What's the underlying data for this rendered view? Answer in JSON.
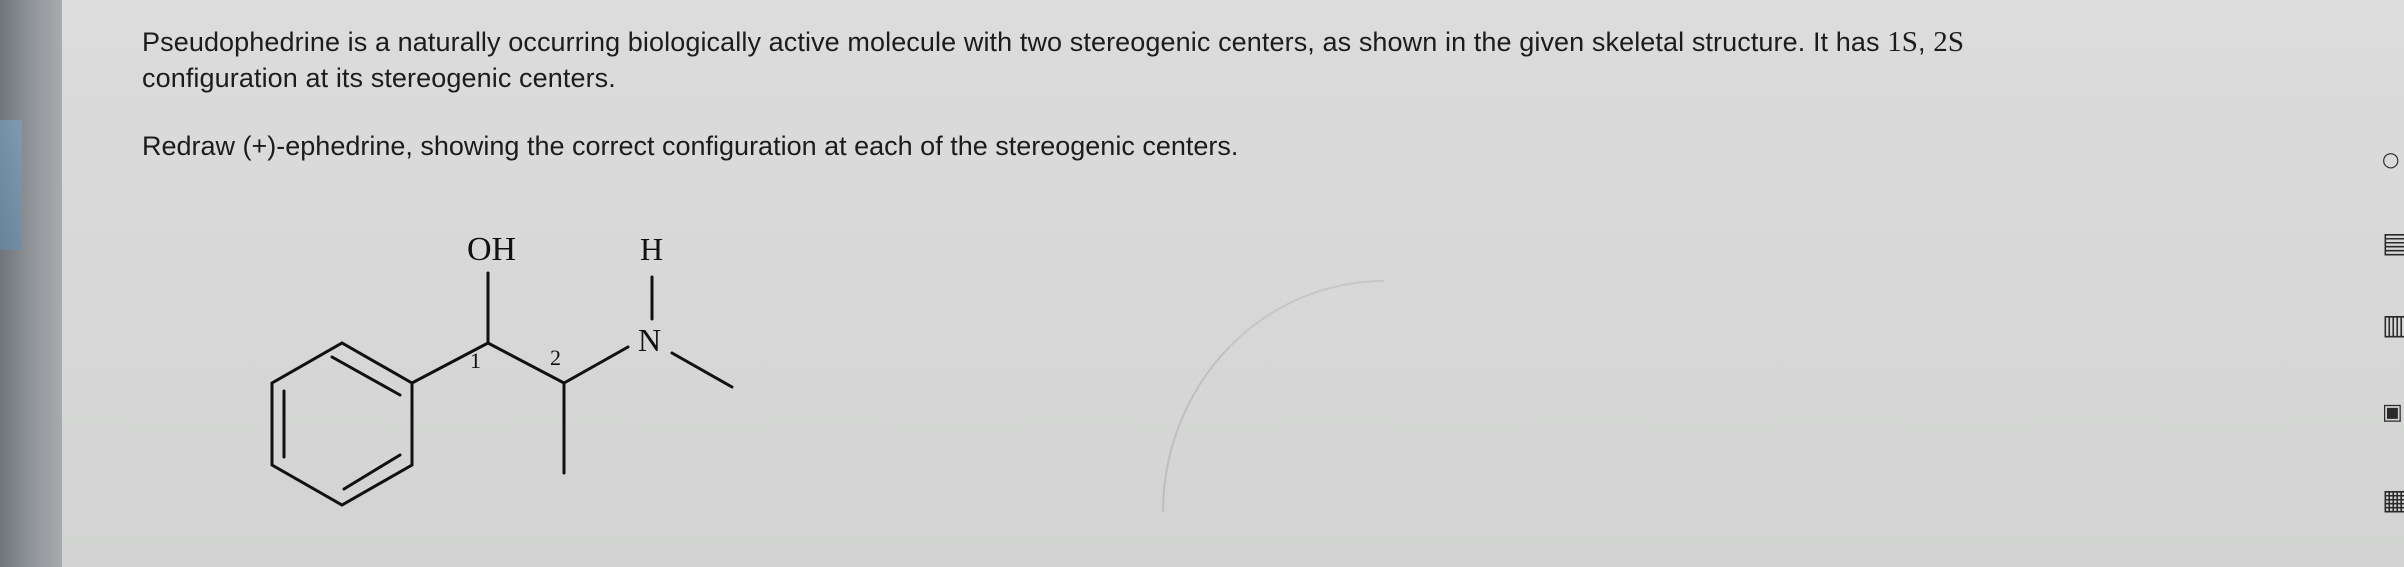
{
  "question": {
    "intro": "Pseudophedrine is a naturally occurring biologically active molecule with two stereogenic centers, as shown in the given skeletal structure. It has ",
    "config_1": "1S",
    "config_sep": ", ",
    "config_2": "2S",
    "outro": "configuration at its stereogenic centers.",
    "instruction": "Redraw (+)-ephedrine, showing the correct configuration at each of the stereogenic centers."
  },
  "molecule": {
    "oh_label": "OH",
    "n_label": "N",
    "h_label": "H",
    "center_1": "1",
    "center_2": "2"
  },
  "toolbar": {
    "icons": [
      "circle-icon",
      "document-icon",
      "bar-chart-icon",
      "text-box-icon",
      "table-icon"
    ]
  }
}
